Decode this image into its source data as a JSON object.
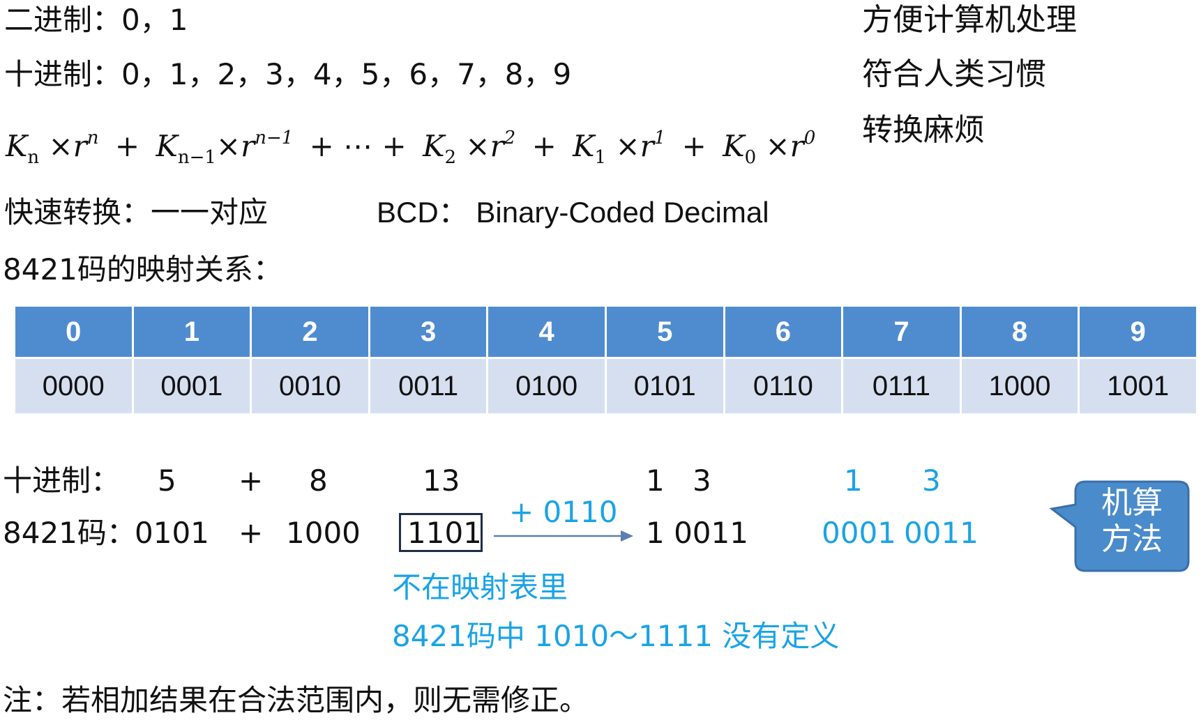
{
  "top": {
    "binary": {
      "label": "二进制：",
      "digits": "0，1",
      "note": "方便计算机处理"
    },
    "decimal": {
      "label": "十进制：",
      "digits": "0，1，2，3，4，5，6，7，8，9",
      "note": "符合人类习惯"
    },
    "formula_note": "转换麻烦"
  },
  "formula": {
    "k": "K",
    "times_r": "×r",
    "plus": "+",
    "ellipsis": "+ ⋯ +",
    "terms": [
      {
        "sub": "n",
        "sup": "n"
      },
      {
        "sub": "n−1",
        "sup": "n−1"
      },
      {
        "sub": "2",
        "sup": "2"
      },
      {
        "sub": "1",
        "sup": "1"
      },
      {
        "sub": "0",
        "sup": "0"
      }
    ]
  },
  "quick": {
    "label": "快速转换：",
    "value": "一一对应",
    "bcd_label": "BCD：",
    "bcd_full": "Binary-Coded Decimal"
  },
  "mapping_title": "8421码的映射关系：",
  "mapping": {
    "digits": [
      "0",
      "1",
      "2",
      "3",
      "4",
      "5",
      "6",
      "7",
      "8",
      "9"
    ],
    "codes": [
      "0000",
      "0001",
      "0010",
      "0011",
      "0100",
      "0101",
      "0110",
      "0111",
      "1000",
      "1001"
    ]
  },
  "example": {
    "decimal_label": "十进制：",
    "code_label": "8421码：",
    "a_dec": "5",
    "plus": "+",
    "b_dec": "8",
    "sum_dec": "13",
    "result_dec_tens": "1",
    "result_dec_ones": "3",
    "a_code": "0101",
    "b_code": "1000",
    "sum_code": "1101",
    "correction": "+ 0110",
    "corrected": "1 0011",
    "final_dec_tens": "1",
    "final_dec_ones": "3",
    "final_code_tens": "0001",
    "final_code_ones": "0011",
    "not_in_table": "不在映射表里",
    "undefined_note": "8421码中 1010～1111 没有定义"
  },
  "callout": {
    "text": "机算方法"
  },
  "footnote": "注：若相加结果在合法范围内，则无需修正。",
  "colors": {
    "header_blue": "#4f8ccf",
    "row_light": "#d5dff0",
    "accent_blue": "#19a3e6",
    "callout_fill": "#4a8bcb"
  }
}
